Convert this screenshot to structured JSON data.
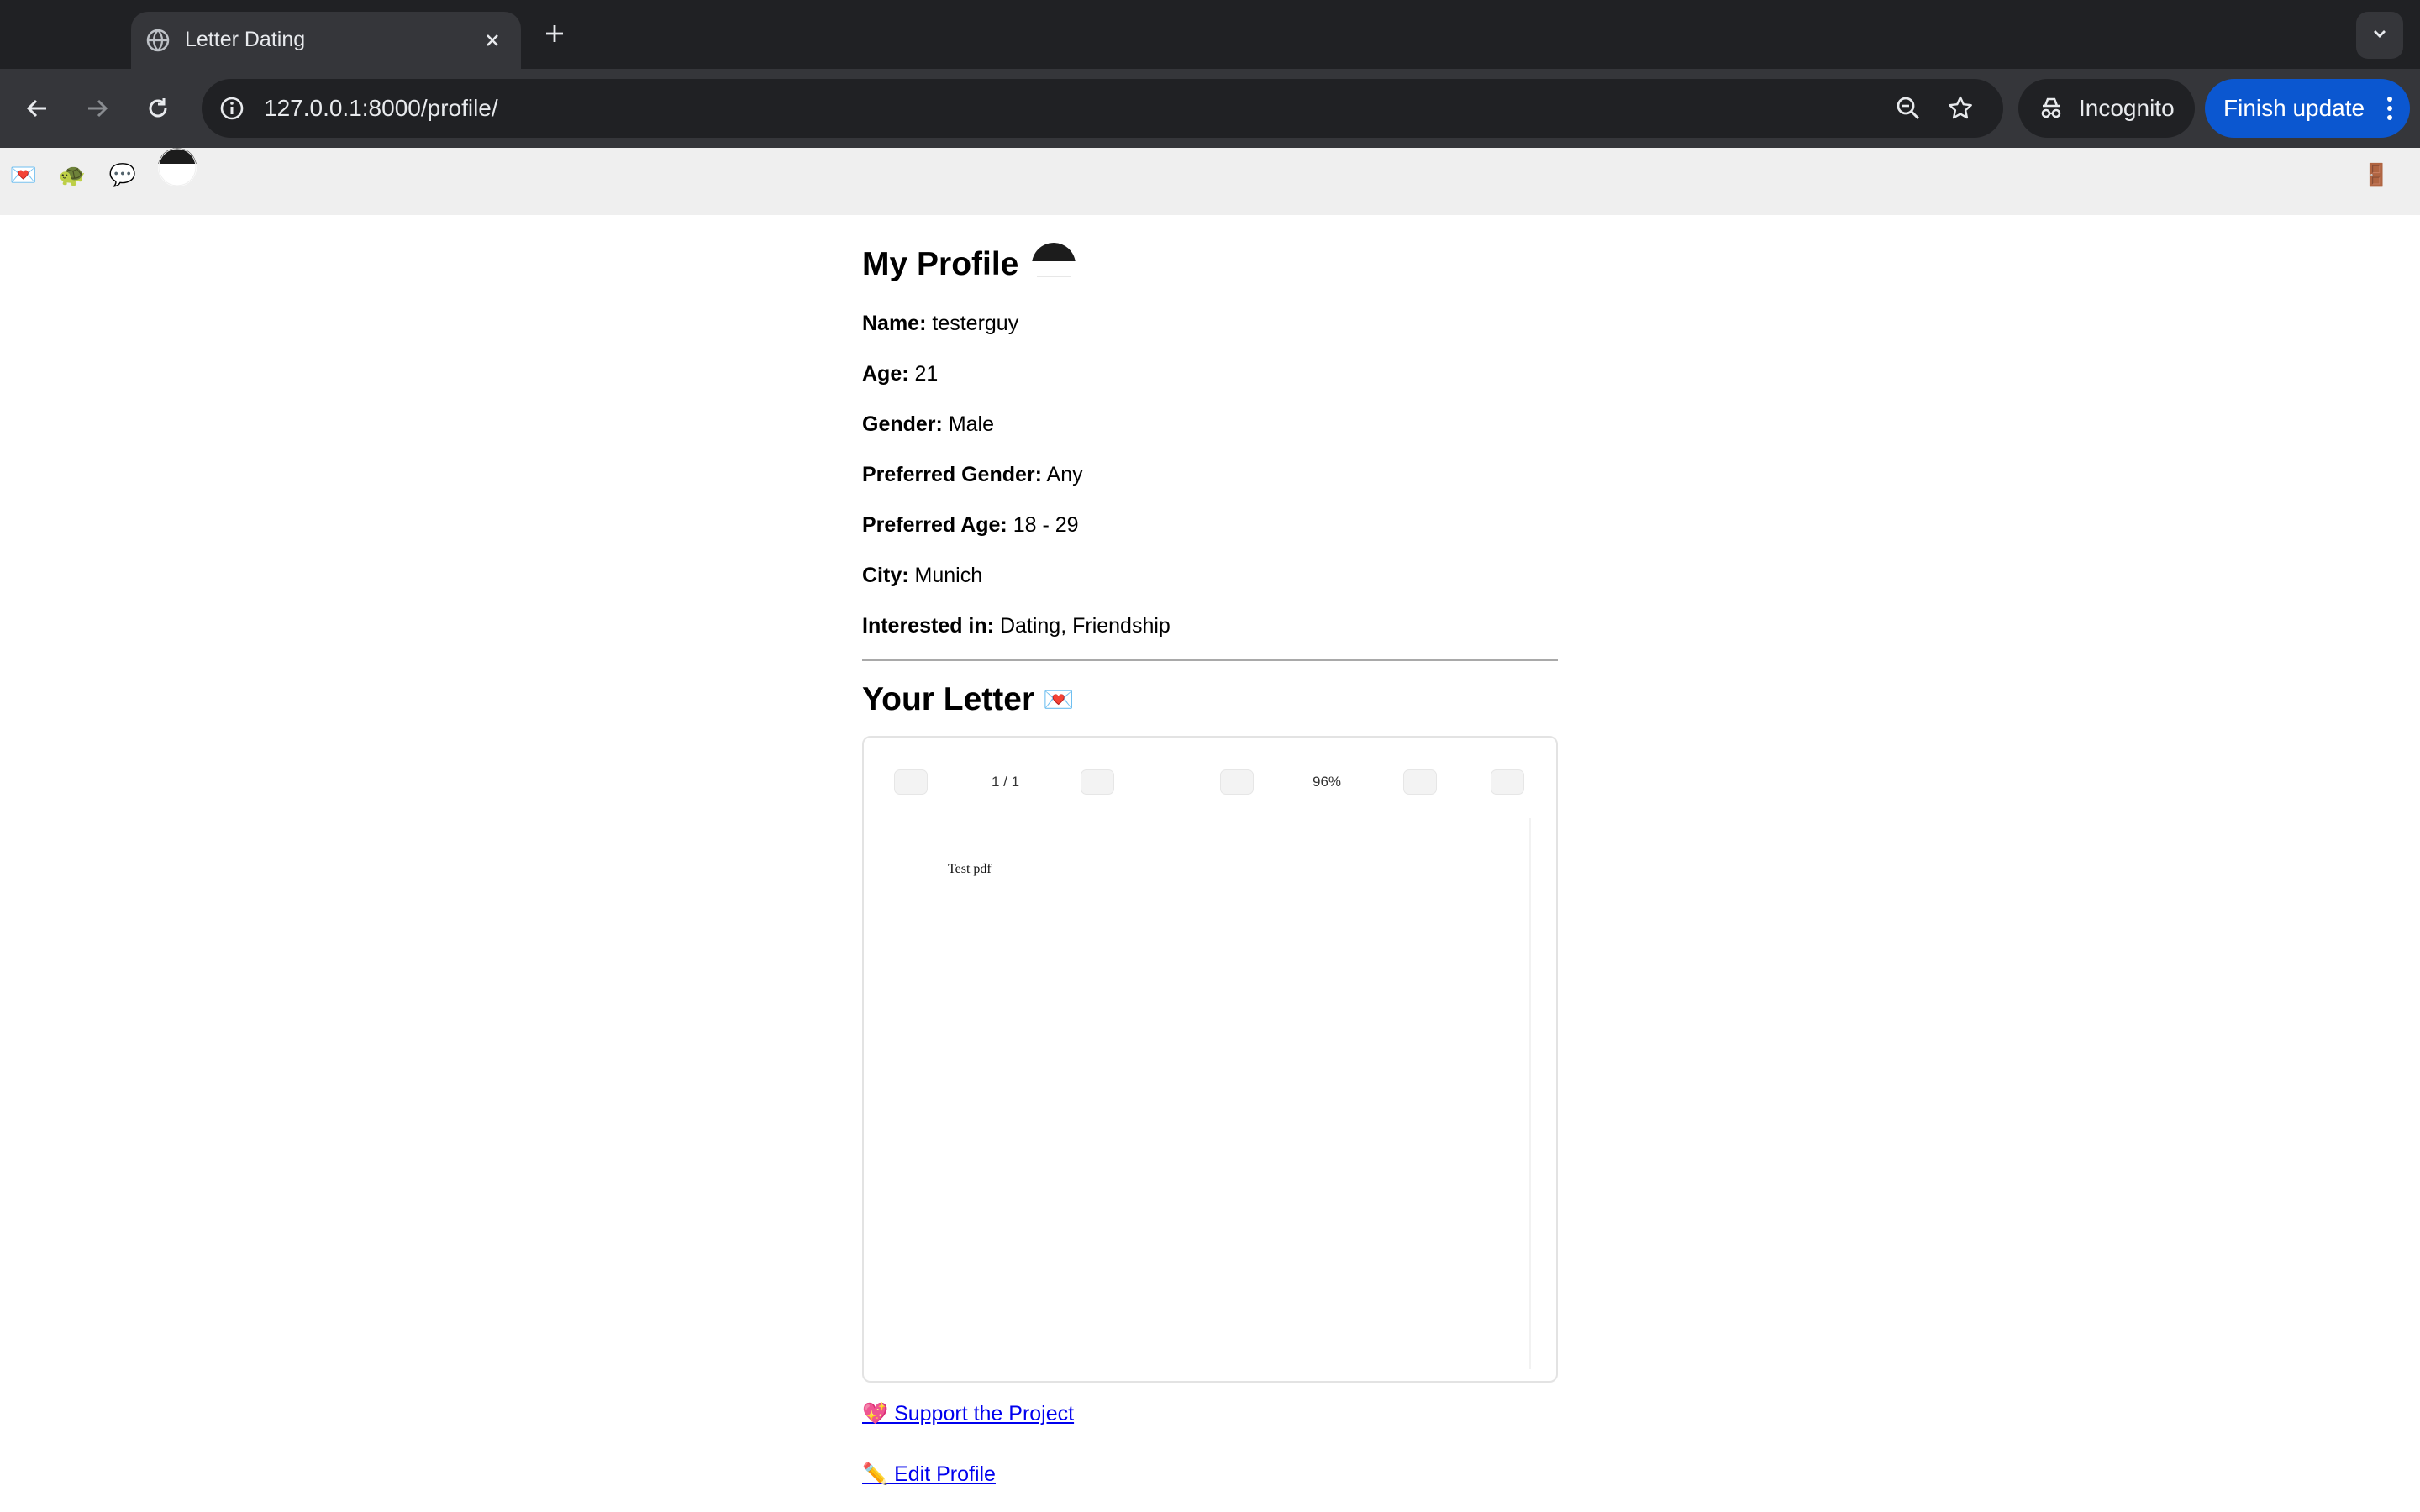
{
  "browser": {
    "tab_title": "Letter Dating",
    "url": "127.0.0.1:8000/profile/",
    "incognito_label": "Incognito",
    "finish_update_label": "Finish update",
    "accent_color": "#0b57d0"
  },
  "site_nav": {
    "items": [
      {
        "icon": "love-letter-icon",
        "glyph": "💌"
      },
      {
        "icon": "turtle-icon",
        "glyph": "🐢"
      },
      {
        "icon": "speech-bubble-icon",
        "glyph": "💬"
      },
      {
        "icon": "avatar"
      }
    ],
    "logout_icon": "door-icon",
    "logout_glyph": "🚪"
  },
  "profile": {
    "title": "My Profile",
    "fields": [
      {
        "label": "Name:",
        "value": "testerguy"
      },
      {
        "label": "Age:",
        "value": "21"
      },
      {
        "label": "Gender:",
        "value": "Male"
      },
      {
        "label": "Preferred Gender:",
        "value": "Any"
      },
      {
        "label": "Preferred Age:",
        "value": "18 - 29"
      },
      {
        "label": "City:",
        "value": "Munich"
      },
      {
        "label": "Interested in:",
        "value": "Dating, Friendship"
      }
    ]
  },
  "letter": {
    "title": "Your Letter",
    "title_emoji": "💌",
    "viewer": {
      "page_indicator": "1 / 1",
      "zoom": "96%",
      "page_text": "Test pdf"
    }
  },
  "links": {
    "support": "💖 Support the Project",
    "edit": "✏️ Edit Profile"
  }
}
